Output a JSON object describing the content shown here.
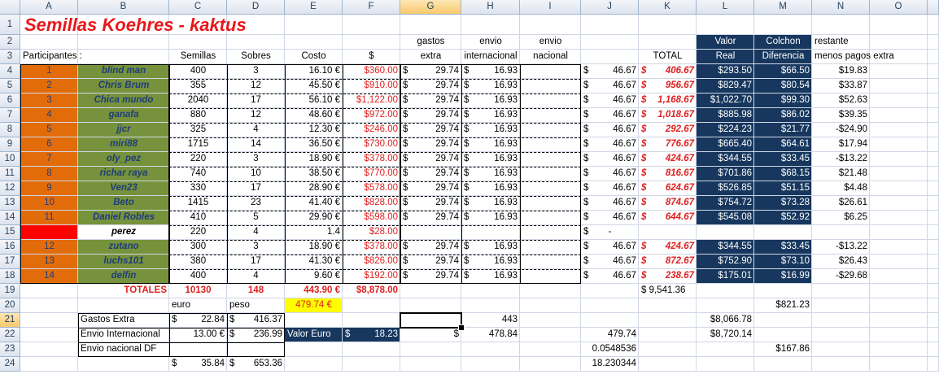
{
  "columns": [
    "A",
    "B",
    "C",
    "D",
    "E",
    "F",
    "G",
    "H",
    "I",
    "J",
    "K",
    "L",
    "M",
    "N",
    "O"
  ],
  "rownums": [
    "1",
    "2",
    "3",
    "4",
    "5",
    "6",
    "7",
    "8",
    "9",
    "10",
    "11",
    "12",
    "13",
    "14",
    "15",
    "16",
    "17",
    "18",
    "19",
    "20",
    "21",
    "22",
    "23",
    "24"
  ],
  "colors": {
    "orange": "#e36c0a",
    "green": "#76923c",
    "navy": "#17375e",
    "yellow": "#ffff00",
    "red_fill": "#ff0000",
    "red_text": "#e02020",
    "name_text": "#1f3d7a"
  },
  "title": "Semillas Koehres - kaktus",
  "headers": {
    "participantes": "Participantes :",
    "semillas": "Semillas",
    "sobres": "Sobres",
    "costo": "Costo",
    "pesos": "$",
    "gastos": "gastos",
    "extra": "extra",
    "envio_h": "envio",
    "internacional": "internacional",
    "envio_i": "envio",
    "nacional": "nacional",
    "total": "TOTAL",
    "valor": "Valor",
    "real": "Real",
    "colchon": "Colchon",
    "diferencia": "Diferencia",
    "restante": "restante",
    "menos": "menos pagos extra"
  },
  "rows": [
    {
      "num": "1",
      "name": "blind man",
      "semillas": "400",
      "sobres": "3",
      "costo": "16.10 €",
      "pesos": "$360.00",
      "g_sym": "$",
      "g_val": "29.74",
      "h_sym": "$",
      "h_val": "16.93",
      "j_sym": "$",
      "j_val": "46.67",
      "k_sym": "$",
      "k_val": "406.67",
      "valor": "$293.50",
      "colchon": "$66.50",
      "restante": "$19.83"
    },
    {
      "num": "2",
      "name": "Chris Brum",
      "semillas": "355",
      "sobres": "12",
      "costo": "45.50 €",
      "pesos": "$910.00",
      "g_sym": "$",
      "g_val": "29.74",
      "h_sym": "$",
      "h_val": "16.93",
      "j_sym": "$",
      "j_val": "46.67",
      "k_sym": "$",
      "k_val": "956.67",
      "valor": "$829.47",
      "colchon": "$80.54",
      "restante": "$33.87"
    },
    {
      "num": "3",
      "name": "Chica mundo",
      "semillas": "2040",
      "sobres": "17",
      "costo": "56.10 €",
      "pesos": "$1,122.00",
      "g_sym": "$",
      "g_val": "29.74",
      "h_sym": "$",
      "h_val": "16.93",
      "j_sym": "$",
      "j_val": "46.67",
      "k_sym": "$",
      "k_val": "1,168.67",
      "valor": "$1,022.70",
      "colchon": "$99.30",
      "restante": "$52.63"
    },
    {
      "num": "4",
      "name": "ganafa",
      "semillas": "880",
      "sobres": "12",
      "costo": "48.60 €",
      "pesos": "$972.00",
      "g_sym": "$",
      "g_val": "29.74",
      "h_sym": "$",
      "h_val": "16.93",
      "j_sym": "$",
      "j_val": "46.67",
      "k_sym": "$",
      "k_val": "1,018.67",
      "valor": "$885.98",
      "colchon": "$86.02",
      "restante": "$39.35"
    },
    {
      "num": "5",
      "name": "jjcr",
      "semillas": "325",
      "sobres": "4",
      "costo": "12.30 €",
      "pesos": "$246.00",
      "g_sym": "$",
      "g_val": "29.74",
      "h_sym": "$",
      "h_val": "16.93",
      "j_sym": "$",
      "j_val": "46.67",
      "k_sym": "$",
      "k_val": "292.67",
      "valor": "$224.23",
      "colchon": "$21.77",
      "restante": "-$24.90"
    },
    {
      "num": "6",
      "name": "miri88",
      "semillas": "1715",
      "sobres": "14",
      "costo": "36.50 €",
      "pesos": "$730.00",
      "g_sym": "$",
      "g_val": "29.74",
      "h_sym": "$",
      "h_val": "16.93",
      "j_sym": "$",
      "j_val": "46.67",
      "k_sym": "$",
      "k_val": "776.67",
      "valor": "$665.40",
      "colchon": "$64.61",
      "restante": "$17.94"
    },
    {
      "num": "7",
      "name": "oly_pez",
      "semillas": "220",
      "sobres": "3",
      "costo": "18.90 €",
      "pesos": "$378.00",
      "g_sym": "$",
      "g_val": "29.74",
      "h_sym": "$",
      "h_val": "16.93",
      "j_sym": "$",
      "j_val": "46.67",
      "k_sym": "$",
      "k_val": "424.67",
      "valor": "$344.55",
      "colchon": "$33.45",
      "restante": "-$13.22"
    },
    {
      "num": "8",
      "name": "richar raya",
      "semillas": "740",
      "sobres": "10",
      "costo": "38.50 €",
      "pesos": "$770.00",
      "g_sym": "$",
      "g_val": "29.74",
      "h_sym": "$",
      "h_val": "16.93",
      "j_sym": "$",
      "j_val": "46.67",
      "k_sym": "$",
      "k_val": "816.67",
      "valor": "$701.86",
      "colchon": "$68.15",
      "restante": "$21.48"
    },
    {
      "num": "9",
      "name": "Ven23",
      "semillas": "330",
      "sobres": "17",
      "costo": "28.90 €",
      "pesos": "$578.00",
      "g_sym": "$",
      "g_val": "29.74",
      "h_sym": "$",
      "h_val": "16.93",
      "j_sym": "$",
      "j_val": "46.67",
      "k_sym": "$",
      "k_val": "624.67",
      "valor": "$526.85",
      "colchon": "$51.15",
      "restante": "$4.48"
    },
    {
      "num": "10",
      "name": "Beto",
      "semillas": "1415",
      "sobres": "23",
      "costo": "41.40 €",
      "pesos": "$828.00",
      "g_sym": "$",
      "g_val": "29.74",
      "h_sym": "$",
      "h_val": "16.93",
      "j_sym": "$",
      "j_val": "46.67",
      "k_sym": "$",
      "k_val": "874.67",
      "valor": "$754.72",
      "colchon": "$73.28",
      "restante": "$26.61"
    },
    {
      "num": "11",
      "name": "Daniel Robles",
      "semillas": "410",
      "sobres": "5",
      "costo": "29.90 €",
      "pesos": "$598.00",
      "g_sym": "$",
      "g_val": "29.74",
      "h_sym": "$",
      "h_val": "16.93",
      "j_sym": "$",
      "j_val": "46.67",
      "k_sym": "$",
      "k_val": "644.67",
      "valor": "$545.08",
      "colchon": "$52.92",
      "restante": "$6.25"
    },
    {
      "num": "",
      "name": "perez",
      "semillas": "220",
      "sobres": "4",
      "costo": "1.4",
      "pesos": "$28.00",
      "g_sym": "",
      "g_val": "",
      "h_sym": "",
      "h_val": "",
      "j_sym": "$",
      "j_val": "-",
      "k_sym": "",
      "k_val": "",
      "valor": "",
      "colchon": "",
      "restante": ""
    },
    {
      "num": "12",
      "name": "zutano",
      "semillas": "300",
      "sobres": "3",
      "costo": "18.90 €",
      "pesos": "$378.00",
      "g_sym": "$",
      "g_val": "29.74",
      "h_sym": "$",
      "h_val": "16.93",
      "j_sym": "$",
      "j_val": "46.67",
      "k_sym": "$",
      "k_val": "424.67",
      "valor": "$344.55",
      "colchon": "$33.45",
      "restante": "-$13.22"
    },
    {
      "num": "13",
      "name": "luchs101",
      "semillas": "380",
      "sobres": "17",
      "costo": "41.30 €",
      "pesos": "$826.00",
      "g_sym": "$",
      "g_val": "29.74",
      "h_sym": "$",
      "h_val": "16.93",
      "j_sym": "$",
      "j_val": "46.67",
      "k_sym": "$",
      "k_val": "872.67",
      "valor": "$752.90",
      "colchon": "$73.10",
      "restante": "$26.43"
    },
    {
      "num": "14",
      "name": "delfin",
      "semillas": "400",
      "sobres": "4",
      "costo": "9.60 €",
      "pesos": "$192.00",
      "g_sym": "$",
      "g_val": "29.74",
      "h_sym": "$",
      "h_val": "16.93",
      "j_sym": "$",
      "j_val": "46.67",
      "k_sym": "$",
      "k_val": "238.67",
      "valor": "$175.01",
      "colchon": "$16.99",
      "restante": "-$29.68"
    }
  ],
  "totals": {
    "label": "TOTALES",
    "semillas": "10130",
    "sobres": "148",
    "costo": "443.90 €",
    "pesos": "$8,878.00",
    "k": "$ 9,541.36"
  },
  "row20": {
    "euro": "euro",
    "peso": "peso",
    "yellow": "479.74 €",
    "m": "$821.23"
  },
  "row21": {
    "label": "Gastos Extra",
    "c_sym": "$",
    "c_val": "22.84",
    "d_sym": "$",
    "d_val": "416.37",
    "h": "443",
    "l": "$8,066.78"
  },
  "row22": {
    "label": "Envio Internacional",
    "c_val": "13.00 €",
    "d_sym": "$",
    "d_val": "236.99",
    "valor_label": "Valor  Euro",
    "valor_sym": "$",
    "valor_val": "18.23",
    "h_sym": "$",
    "h_val": "478.84",
    "j": "479.74",
    "l": "$8,720.14"
  },
  "row23": {
    "label": "Envio nacional DF",
    "j": "0.0548536",
    "m": "$167.86"
  },
  "row24": {
    "c_sym": "$",
    "c_val": "35.84",
    "d_sym": "$",
    "d_val": "653.36",
    "j": "18.230344"
  }
}
